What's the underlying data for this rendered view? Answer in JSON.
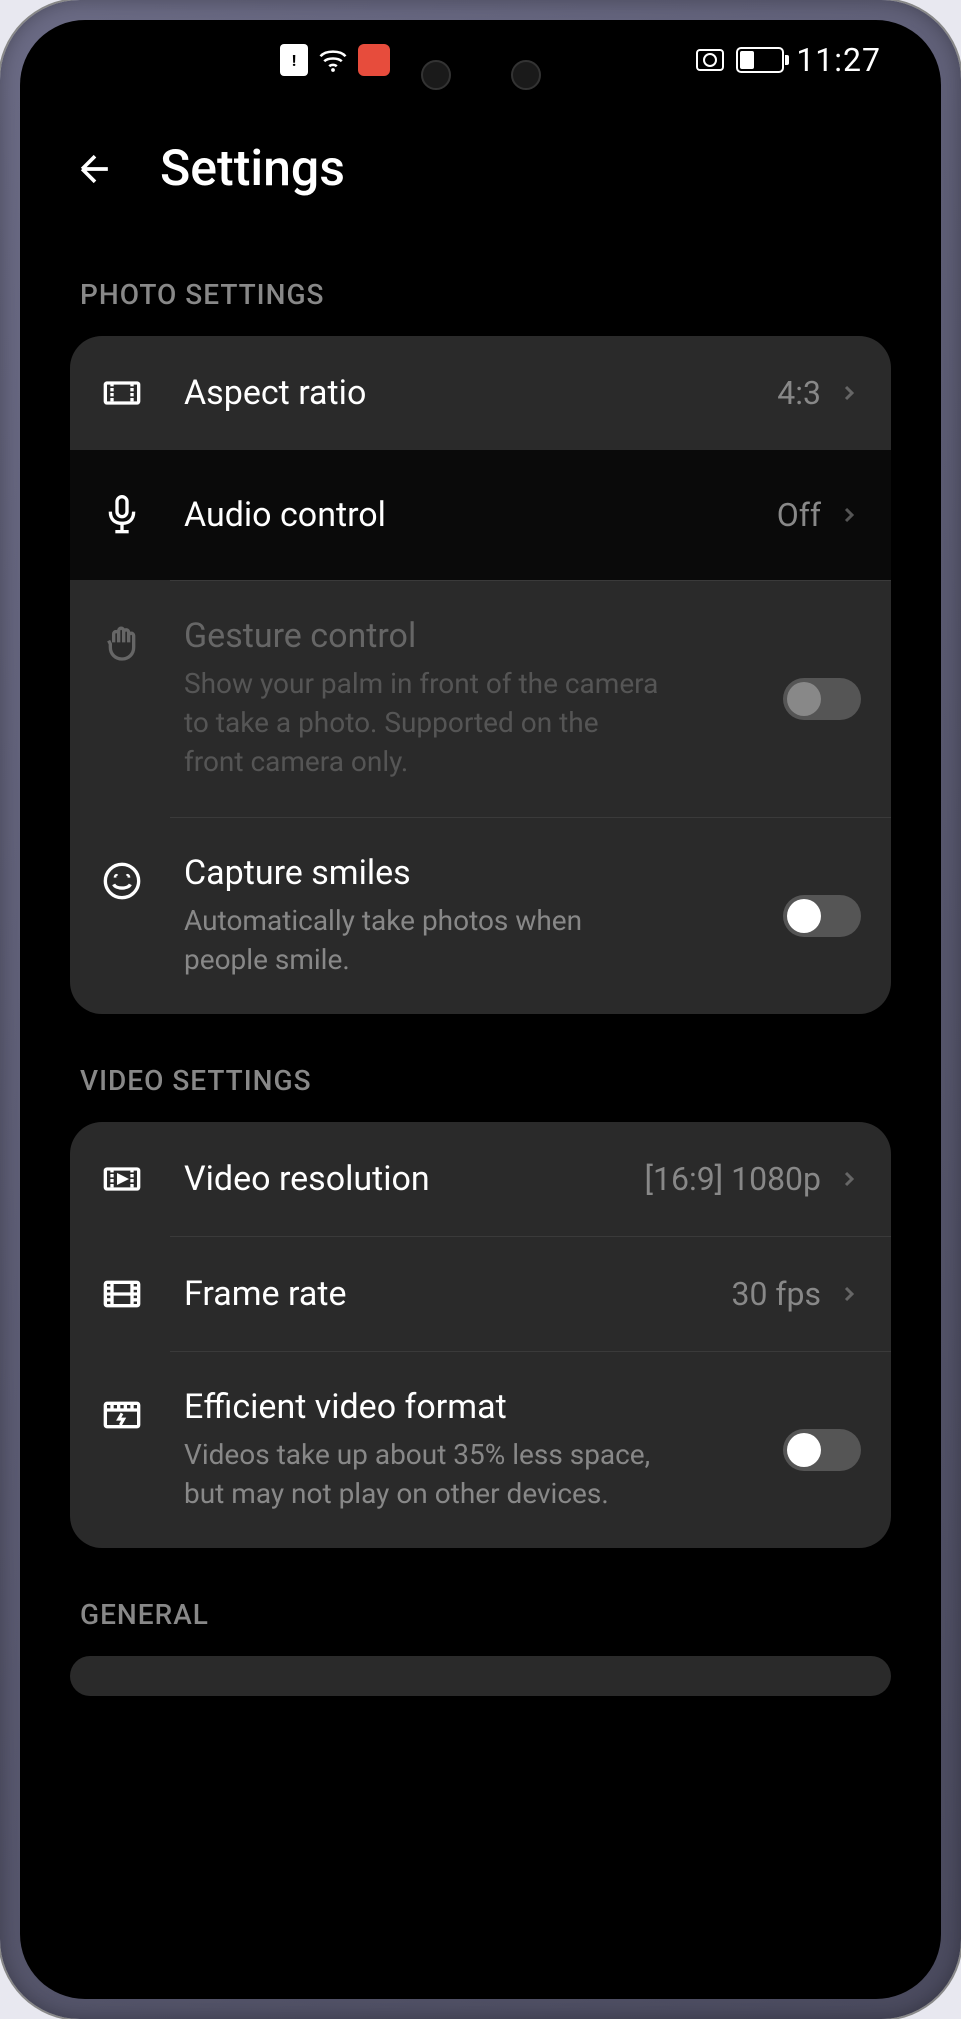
{
  "status_bar": {
    "time": "11:27"
  },
  "header": {
    "title": "Settings"
  },
  "sections": {
    "photo": {
      "header": "PHOTO SETTINGS",
      "aspect_ratio": {
        "label": "Aspect ratio",
        "value": "4:3"
      },
      "audio_control": {
        "label": "Audio control",
        "value": "Off"
      },
      "gesture_control": {
        "label": "Gesture control",
        "description": "Show your palm in front of the camera to take a photo. Supported on the front camera only."
      },
      "capture_smiles": {
        "label": "Capture smiles",
        "description": "Automatically take photos when people smile."
      }
    },
    "video": {
      "header": "VIDEO SETTINGS",
      "resolution": {
        "label": "Video resolution",
        "value": "[16:9] 1080p"
      },
      "frame_rate": {
        "label": "Frame rate",
        "value": "30 fps"
      },
      "efficient_format": {
        "label": "Efficient video format",
        "description": "Videos take up about 35% less space, but may not play on other devices."
      }
    },
    "general": {
      "header": "GENERAL"
    }
  }
}
